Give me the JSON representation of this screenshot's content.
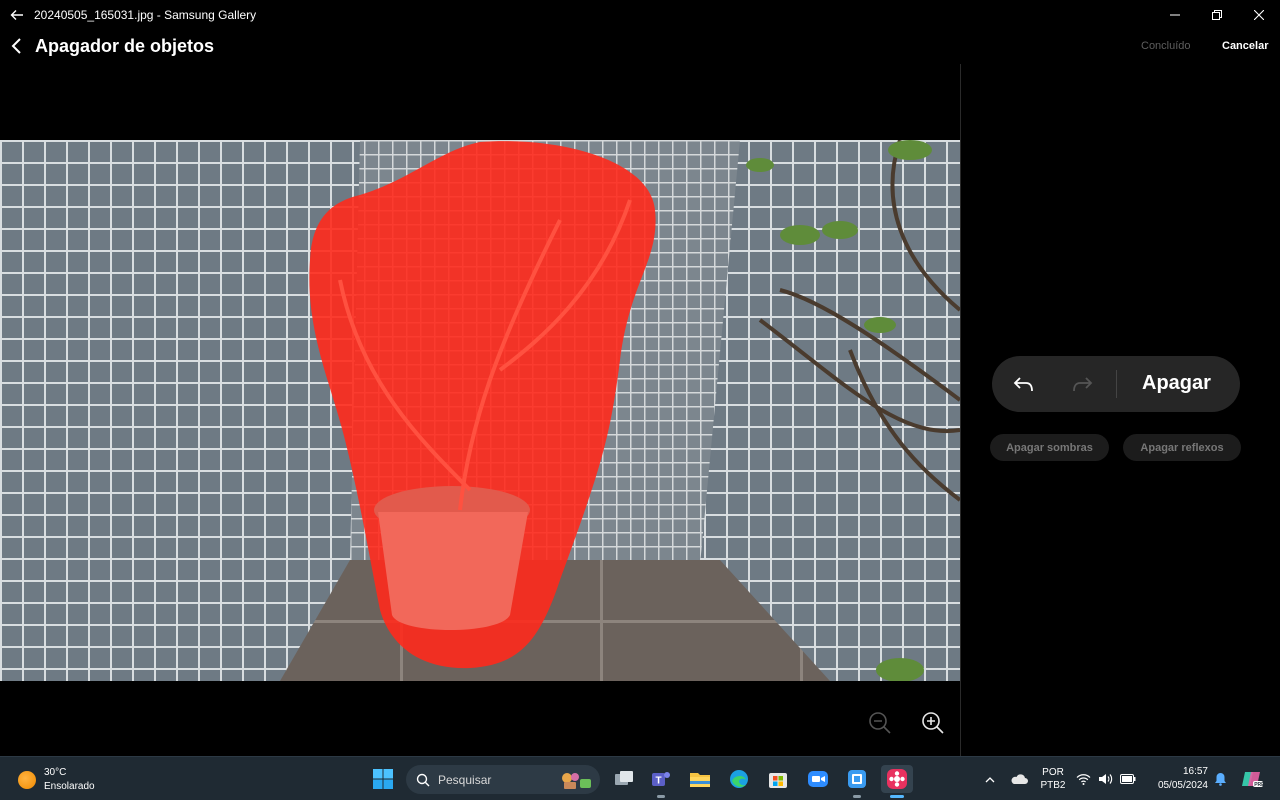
{
  "window": {
    "title": "20240505_165031.jpg - Samsung Gallery"
  },
  "header": {
    "title": "Apagador de objetos",
    "done_label": "Concluído",
    "cancel_label": "Cancelar"
  },
  "panel": {
    "erase_label": "Apagar",
    "erase_shadows_label": "Apagar sombras",
    "erase_reflections_label": "Apagar reflexos"
  },
  "icons": {
    "back": "arrow-left-icon",
    "undo": "undo-icon",
    "redo": "redo-icon",
    "zoom_out": "zoom-out-icon",
    "zoom_in": "zoom-in-icon"
  },
  "colors": {
    "selection_mask": "#ff2a1c",
    "accent": "#55b8ff",
    "disabled_text": "#5e5e5e"
  },
  "taskbar": {
    "weather": {
      "temp": "30°C",
      "condition": "Ensolarado"
    },
    "search_placeholder": "Pesquisar",
    "tray": {
      "lang_top": "POR",
      "lang_bottom": "PTB2",
      "time": "16:57",
      "date": "05/05/2024"
    }
  }
}
